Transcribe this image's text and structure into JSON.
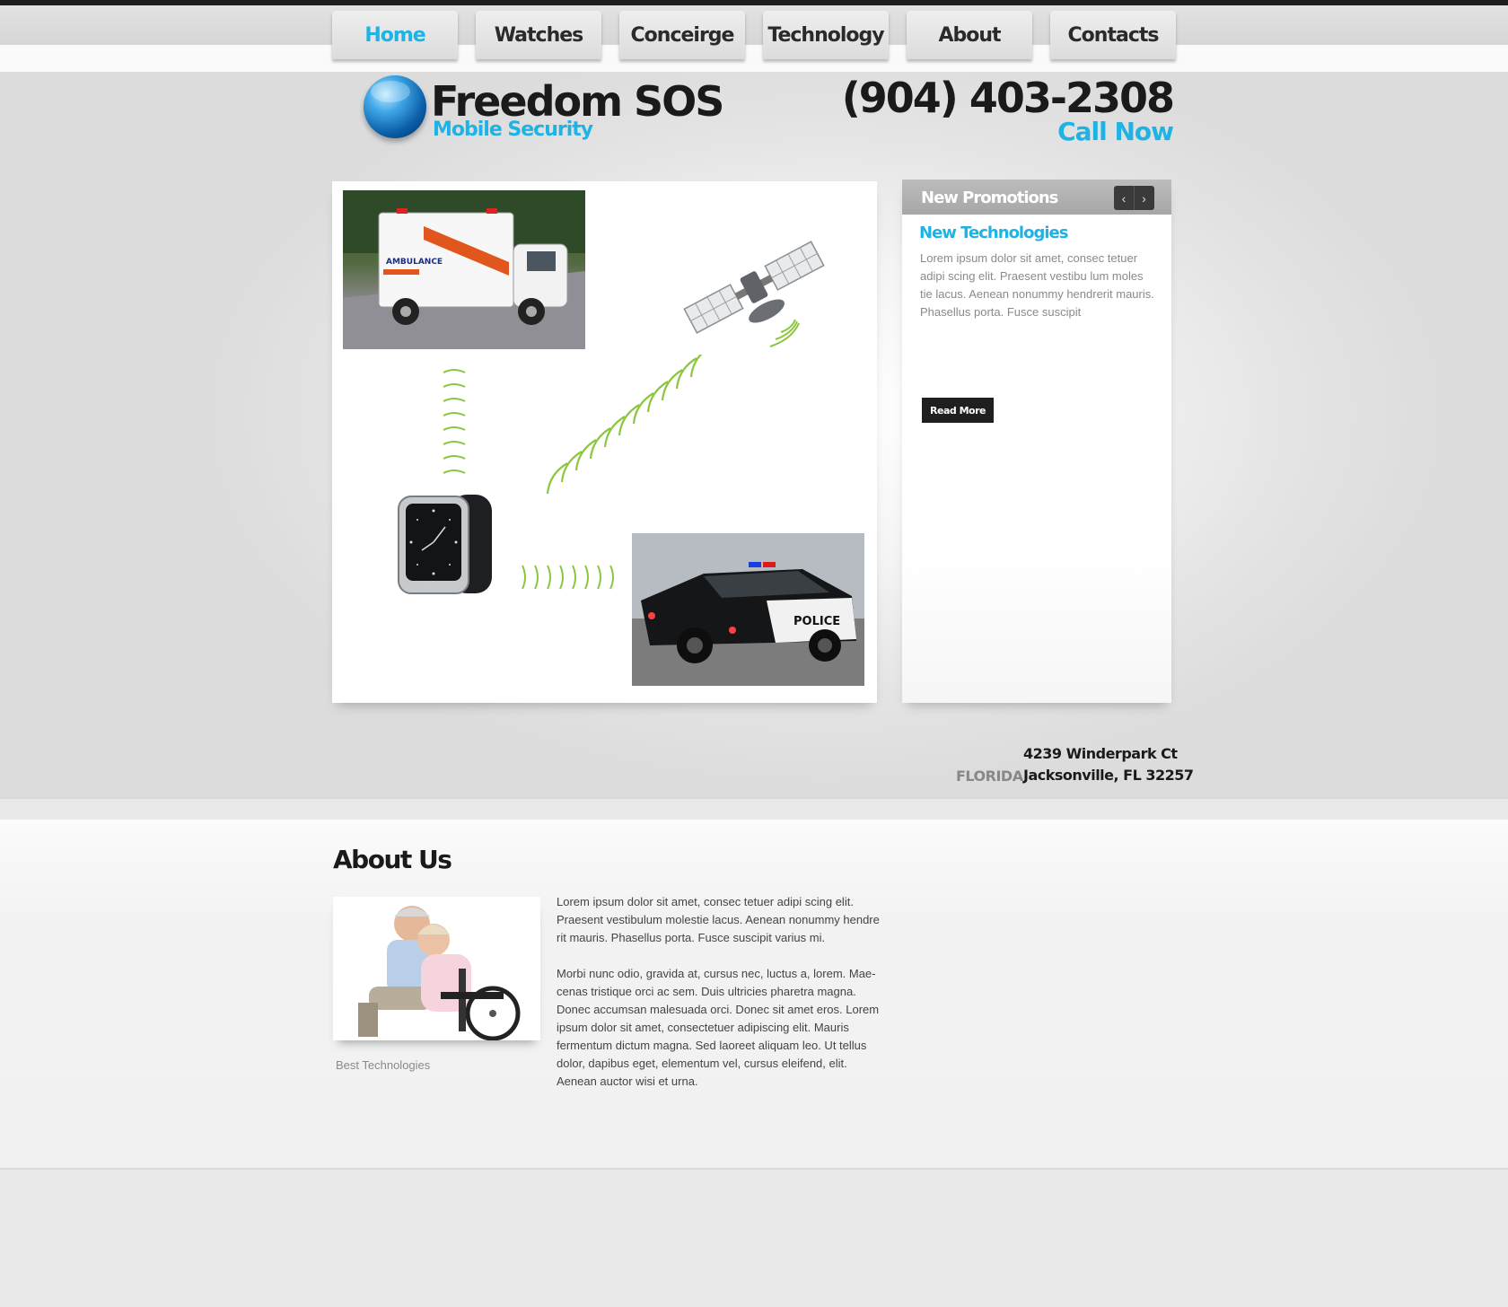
{
  "nav": {
    "items": [
      {
        "label": "Home",
        "active": true
      },
      {
        "label": "Watches"
      },
      {
        "label": "Conceirge"
      },
      {
        "label": "Technology"
      },
      {
        "label": "About"
      },
      {
        "label": "Contacts"
      }
    ]
  },
  "header": {
    "logo_title": "Freedom SOS",
    "logo_subtitle": "Mobile Security",
    "phone": "(904) 403-2308",
    "call_label": "Call Now"
  },
  "promo": {
    "heading": "New Promotions",
    "prev_icon": "chevron-left",
    "next_icon": "chevron-right",
    "title": "New Technologies",
    "text": "Lorem ipsum dolor sit amet, consec tetuer adipi scing elit. Praesent vestibu lum moles tie lacus. Aenean nonummy hendrerit mauris. Phasellus porta. Fusce suscipit",
    "button_label": "Read More"
  },
  "address": {
    "line1": "4239 Winderpark Ct",
    "line2": "Jacksonville, FL 32257",
    "state": "FLORIDA"
  },
  "about": {
    "heading": "About Us",
    "caption": "Best Technologies",
    "paragraph1": "Lorem ipsum dolor sit amet, consec tetuer adipi scing elit. Praesent vestibulum molestie lacus. Aenean nonummy hendre rit mauris. Phasellus porta. Fusce suscipit varius mi.",
    "paragraph2": "Morbi nunc odio, gravida at, cursus nec, luctus a, lorem. Mae-cenas tristique orci ac sem. Duis ultricies pharetra magna. Donec accumsan malesuada orci. Donec sit amet eros. Lorem ipsum dolor sit amet, consectetuer adipiscing elit. Mauris fermentum dictum magna. Sed laoreet aliquam leo. Ut tellus dolor, dapibus eget, elementum vel, cursus eleifend, elit. Aenean auctor wisi et urna."
  },
  "colors": {
    "accent": "#1fb3e3",
    "dark": "#1a1a1a",
    "signal": "#8cc63f"
  }
}
